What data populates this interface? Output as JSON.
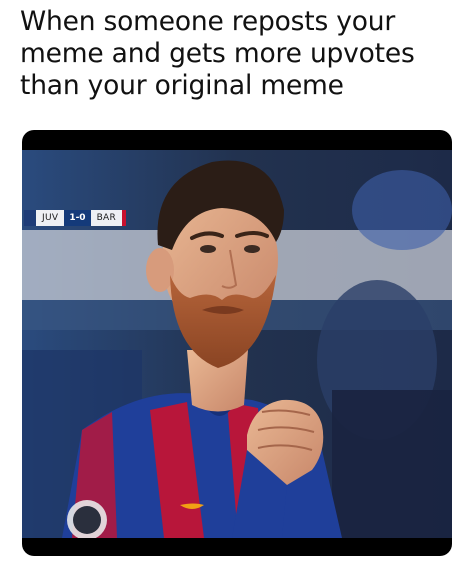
{
  "meme": {
    "caption_lines": [
      "When someone reposts your",
      "meme and gets more upvotes",
      "than your original meme"
    ]
  },
  "scoreboard": {
    "home_team": "JUV",
    "score": "1-0",
    "away_team": "BAR"
  },
  "colors": {
    "frame": "#000000",
    "jersey_blue": "#1f3f9a",
    "jersey_red": "#b8163a",
    "background_blue": "#1b2c4d"
  }
}
